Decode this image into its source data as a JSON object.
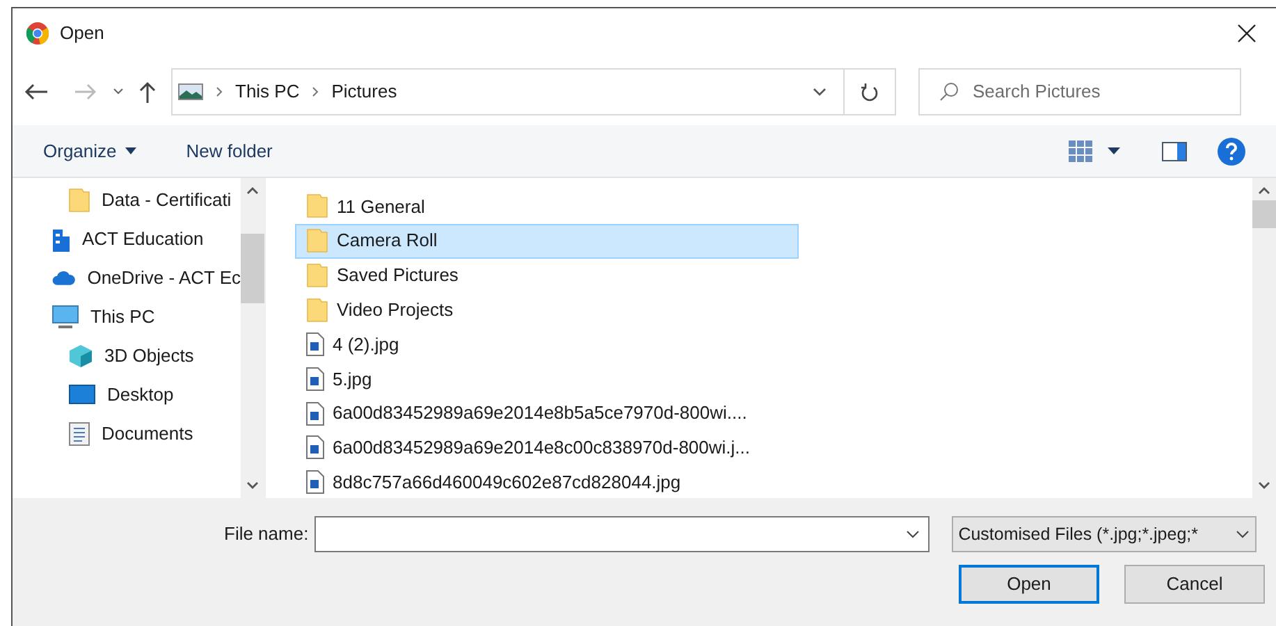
{
  "window": {
    "title": "Open"
  },
  "address": {
    "path": [
      "This PC",
      "Pictures"
    ],
    "search_placeholder": "Search Pictures"
  },
  "toolbar": {
    "buttons": [
      "Organize",
      "New folder"
    ]
  },
  "sidebar": {
    "items": [
      {
        "children": [
          {
            "label": "Data - Certificati",
            "kind": "folder"
          }
        ]
      },
      {
        "label": "ACT Education",
        "kind": "building"
      },
      {
        "label": "OneDrive - ACT Ec",
        "kind": "cloud"
      },
      {
        "label": "This PC",
        "kind": "pc",
        "children": [
          {
            "label": "3D Objects",
            "kind": "cube"
          },
          {
            "label": "Desktop",
            "kind": "desktop"
          },
          {
            "label": "Documents",
            "kind": "document"
          }
        ]
      }
    ]
  },
  "files": [
    {
      "name": "11 General",
      "kind": "folder",
      "selected": false
    },
    {
      "name": "Camera Roll",
      "kind": "folder",
      "selected": true
    },
    {
      "name": "Saved Pictures",
      "kind": "folder",
      "selected": false
    },
    {
      "name": "Video Projects",
      "kind": "folder",
      "selected": false
    },
    {
      "name": "4 (2).jpg",
      "kind": "image",
      "selected": false
    },
    {
      "name": "5.jpg",
      "kind": "image",
      "selected": false
    },
    {
      "name": "6a00d83452989a69e2014e8b5a5ce7970d-800wi....",
      "kind": "image",
      "selected": false
    },
    {
      "name": "6a00d83452989a69e2014e8c00c838970d-800wi.j...",
      "kind": "image",
      "selected": false
    },
    {
      "name": "8d8c757a66d460049c602e87cd828044.jpg",
      "kind": "image",
      "selected": false
    }
  ],
  "footer": {
    "file_name_label": "File name:",
    "file_type": "Customised Files (*.jpg;*.jpeg;*",
    "buttons": [
      "Open",
      "Cancel"
    ]
  }
}
